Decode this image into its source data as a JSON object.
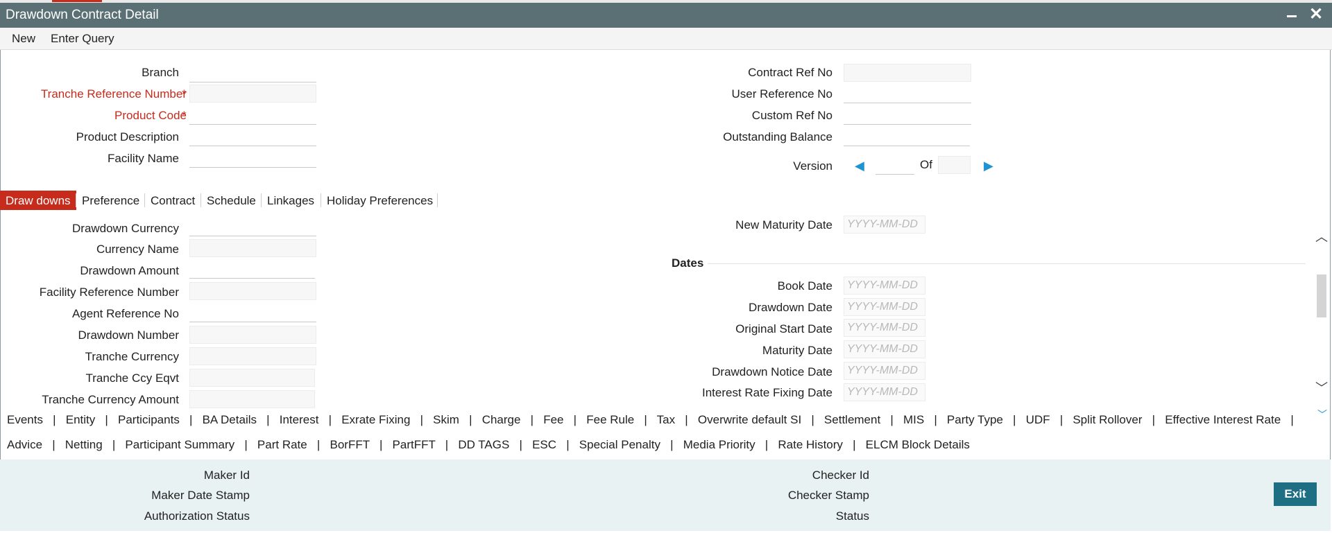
{
  "window": {
    "title": "Drawdown Contract Detail"
  },
  "toolbar": {
    "new_label": "New",
    "enter_query_label": "Enter Query"
  },
  "header_left": {
    "branch": "Branch",
    "tranche_ref": "Tranche Reference Number",
    "product_code": "Product Code",
    "product_desc": "Product Description",
    "facility_name": "Facility Name",
    "required_mark": "*"
  },
  "header_right": {
    "contract_ref": "Contract Ref No",
    "user_ref": "User Reference No",
    "custom_ref": "Custom Ref No",
    "outstanding": "Outstanding Balance",
    "version": "Version",
    "of": "Of"
  },
  "tabs": [
    {
      "label": "Draw downs"
    },
    {
      "label": "Preference"
    },
    {
      "label": "Contract"
    },
    {
      "label": "Schedule"
    },
    {
      "label": "Linkages"
    },
    {
      "label": "Holiday Preferences"
    }
  ],
  "drawdowns_left": {
    "currency": "Drawdown Currency",
    "currency_name": "Currency Name",
    "amount": "Drawdown Amount",
    "facility_ref": "Facility Reference Number",
    "agent_ref": "Agent Reference No",
    "number": "Drawdown Number",
    "tranche_ccy": "Tranche Currency",
    "tranche_eqvt": "Tranche Ccy Eqvt",
    "tranche_amount": "Tranche Currency Amount"
  },
  "drawdowns_right": {
    "new_maturity": "New Maturity Date",
    "dates_section": "Dates",
    "book_date": "Book Date",
    "drawdown_date": "Drawdown Date",
    "original_start": "Original Start Date",
    "maturity_date": "Maturity Date",
    "notice_date": "Drawdown Notice Date",
    "rate_fixing": "Interest Rate Fixing Date",
    "date_placeholder": "YYYY-MM-DD"
  },
  "links_row1": "Events   |   Entity   |   Participants   |   BA Details   |   Interest   |   Exrate Fixing   |   Skim   |   Charge   |   Fee   |   Fee Rule   |   Tax   |   Overwrite default SI   |   Settlement   |   MIS   |   Party Type   |   UDF   |   Split Rollover   |   Effective Interest Rate   |",
  "links_row2": "Advice   |   Netting   |   Participant Summary   |   Part Rate   |   BorFFT   |   PartFFT   |   DD TAGS   |   ESC   |   Special Penalty   |   Media Priority   |   Rate History   |   ELCM Block Details",
  "footer": {
    "maker_id": "Maker Id",
    "maker_stamp": "Maker Date Stamp",
    "auth_status": "Authorization Status",
    "checker_id": "Checker Id",
    "checker_stamp": "Checker Stamp",
    "status": "Status",
    "exit_label": "Exit"
  }
}
